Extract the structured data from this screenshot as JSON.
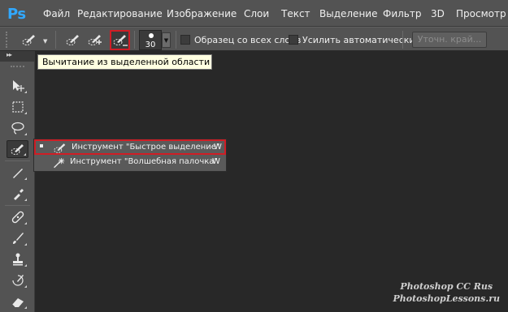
{
  "app": {
    "logo": "Ps"
  },
  "menu": {
    "items": [
      "Файл",
      "Редактирование",
      "Изображение",
      "Слои",
      "Текст",
      "Выделение",
      "Фильтр",
      "3D",
      "Просмотр"
    ]
  },
  "options": {
    "brush_size": "30",
    "sample_all_layers_label": "Образец со всех слоев",
    "auto_enhance_label": "Усилить автоматически",
    "refine_edge_label": "Уточн. край..."
  },
  "tooltip": {
    "text": "Вычитание из выделенной области"
  },
  "flyout": {
    "items": [
      {
        "label": "Инструмент \"Быстрое выделение\"",
        "shortcut": "W"
      },
      {
        "label": "Инструмент \"Волшебная палочка\"",
        "shortcut": "W"
      }
    ]
  },
  "watermark": {
    "line1": "Photoshop CC Rus",
    "line2": "PhotoshopLessons.ru"
  },
  "colors": {
    "highlight": "#d01d25",
    "tooltip_bg": "#ffffe1",
    "logo": "#31a8ff"
  }
}
